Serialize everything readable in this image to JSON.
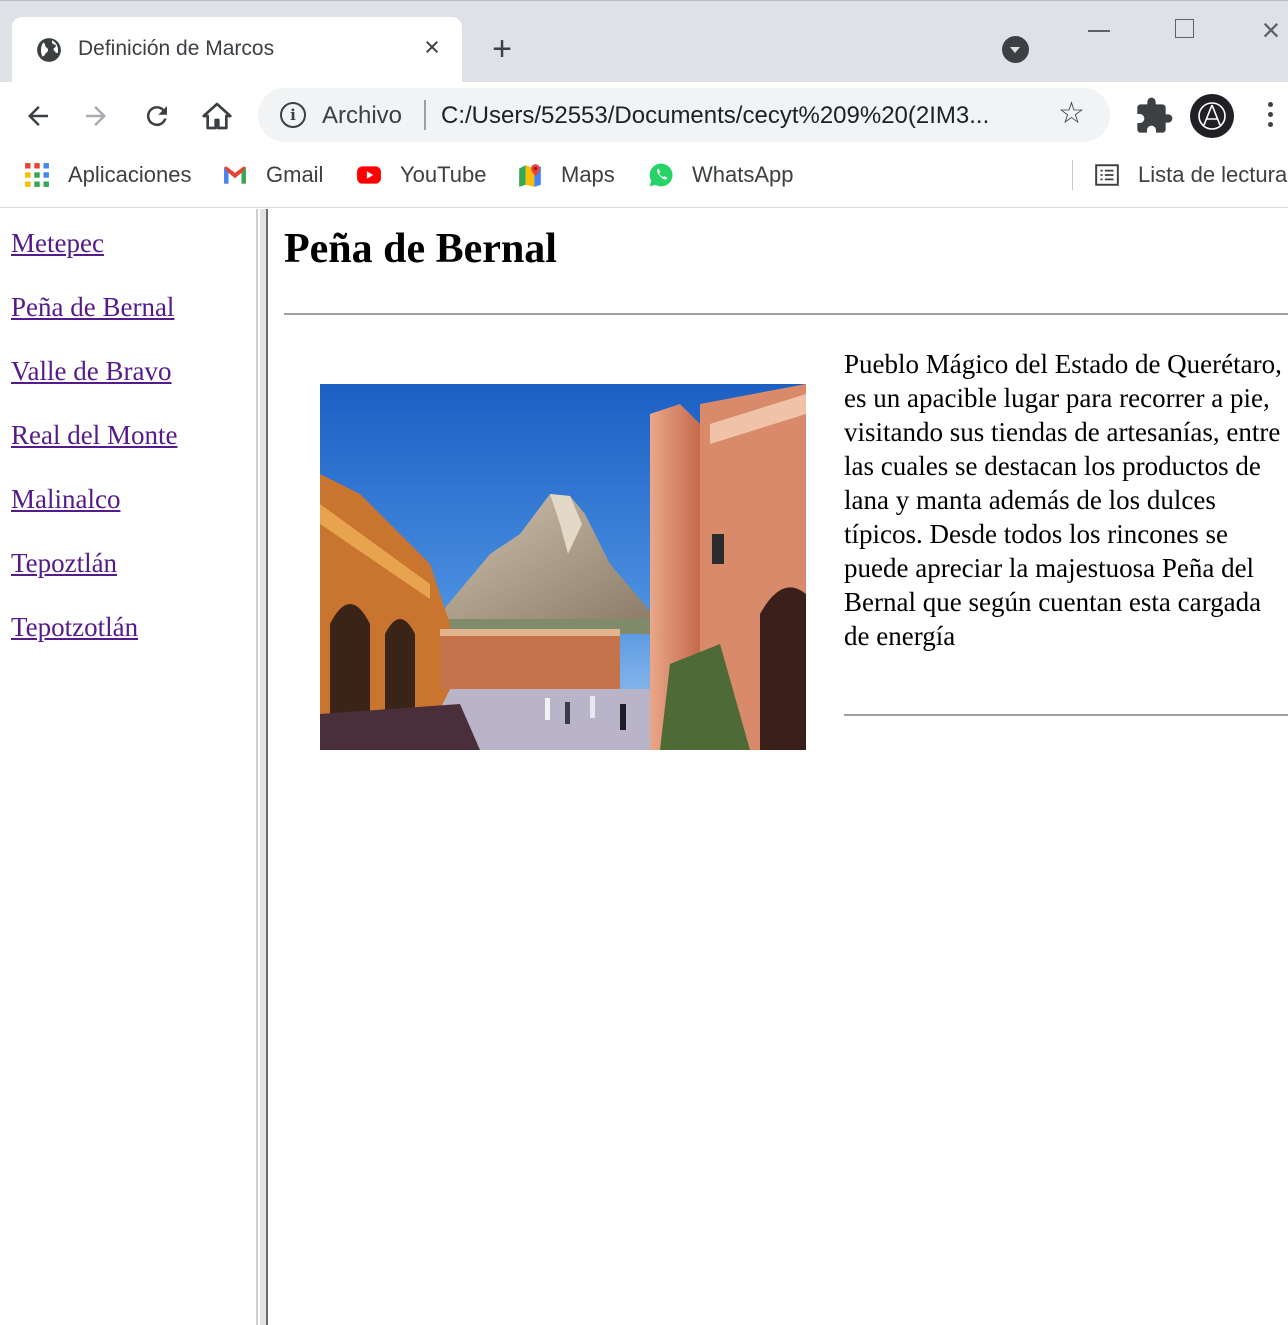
{
  "browser": {
    "tab_title": "Definición de Marcos",
    "tab_close": "×",
    "new_tab": "+",
    "address": {
      "scheme_label": "Archivo",
      "url": "C:/Users/52553/Documents/cecyt%209%20(2IM3..."
    }
  },
  "bookmarks": {
    "items": [
      {
        "label": "Aplicaciones",
        "icon": "apps-grid-icon"
      },
      {
        "label": "Gmail",
        "icon": "gmail-icon"
      },
      {
        "label": "YouTube",
        "icon": "youtube-icon"
      },
      {
        "label": "Maps",
        "icon": "maps-icon"
      },
      {
        "label": "WhatsApp",
        "icon": "whatsapp-icon"
      }
    ],
    "reading_list": "Lista de lectura"
  },
  "nav": {
    "links": [
      "Metepec",
      "Peña de Bernal",
      "Valle de Bravo",
      "Real del Monte",
      "Malinalco",
      "Tepoztlán",
      "Tepotzotlán"
    ]
  },
  "content": {
    "title": "Peña de Bernal",
    "description": "Pueblo Mágico del Estado de Querétaro, es un apacible lugar para recorrer a pie, visitando sus tiendas de artesanías, entre las cuales se destacan los productos de lana y manta además de los dulces típicos. Desde todos los rincones se puede apreciar la majestuosa Peña del Bernal que según cuentan esta cargada de energía"
  },
  "colors": {
    "visited_link": "#551a8b",
    "chrome_bg": "#dee1e6",
    "omnibox_bg": "#f1f3f4"
  }
}
